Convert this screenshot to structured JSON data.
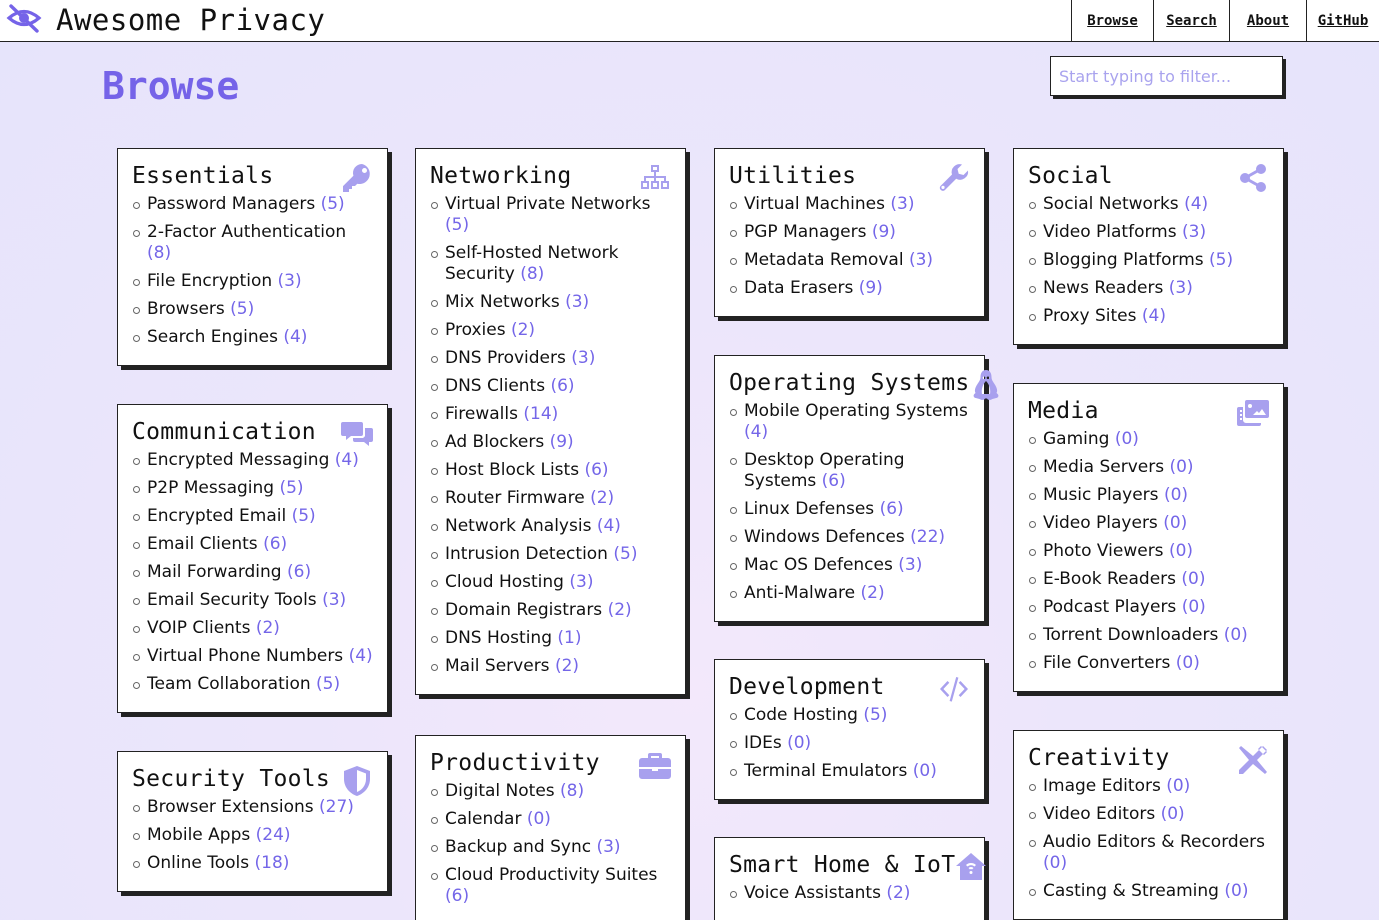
{
  "nav": {
    "brand": "Awesome Privacy",
    "links": [
      "Browse",
      "Search",
      "About",
      "GitHub"
    ]
  },
  "page": {
    "title": "Browse",
    "filter_placeholder": "Start typing to filter..."
  },
  "colors": {
    "accent": "#7563e8",
    "icon": "#a8a0ee",
    "border": "#222222"
  },
  "cards": [
    {
      "title": "Essentials",
      "icon": "key-icon",
      "items": [
        {
          "label": "Password Managers",
          "count": "(5)"
        },
        {
          "label": "2-Factor Authentication",
          "count": "(8)"
        },
        {
          "label": "File Encryption",
          "count": "(3)"
        },
        {
          "label": "Browsers",
          "count": "(5)"
        },
        {
          "label": "Search Engines",
          "count": "(4)"
        }
      ]
    },
    {
      "title": "Communication",
      "icon": "chat-icon",
      "items": [
        {
          "label": "Encrypted Messaging",
          "count": "(4)"
        },
        {
          "label": "P2P Messaging",
          "count": "(5)"
        },
        {
          "label": "Encrypted Email",
          "count": "(5)"
        },
        {
          "label": "Email Clients",
          "count": "(6)"
        },
        {
          "label": "Mail Forwarding",
          "count": "(6)"
        },
        {
          "label": "Email Security Tools",
          "count": "(3)"
        },
        {
          "label": "VOIP Clients",
          "count": "(2)"
        },
        {
          "label": "Virtual Phone Numbers",
          "count": "(4)"
        },
        {
          "label": "Team Collaboration",
          "count": "(5)"
        }
      ]
    },
    {
      "title": "Security Tools",
      "icon": "shield-icon",
      "items": [
        {
          "label": "Browser Extensions",
          "count": "(27)"
        },
        {
          "label": "Mobile Apps",
          "count": "(24)"
        },
        {
          "label": "Online Tools",
          "count": "(18)"
        }
      ]
    },
    {
      "title": "Networking",
      "icon": "network-icon",
      "items": [
        {
          "label": "Virtual Private Networks",
          "count": "(5)"
        },
        {
          "label": "Self-Hosted Network Security",
          "count": "(8)"
        },
        {
          "label": "Mix Networks",
          "count": "(3)"
        },
        {
          "label": "Proxies",
          "count": "(2)"
        },
        {
          "label": "DNS Providers",
          "count": "(3)"
        },
        {
          "label": "DNS Clients",
          "count": "(6)"
        },
        {
          "label": "Firewalls",
          "count": "(14)"
        },
        {
          "label": "Ad Blockers",
          "count": "(9)"
        },
        {
          "label": "Host Block Lists",
          "count": "(6)"
        },
        {
          "label": "Router Firmware",
          "count": "(2)"
        },
        {
          "label": "Network Analysis",
          "count": "(4)"
        },
        {
          "label": "Intrusion Detection",
          "count": "(5)"
        },
        {
          "label": "Cloud Hosting",
          "count": "(3)"
        },
        {
          "label": "Domain Registrars",
          "count": "(2)"
        },
        {
          "label": "DNS Hosting",
          "count": "(1)"
        },
        {
          "label": "Mail Servers",
          "count": "(2)"
        }
      ]
    },
    {
      "title": "Productivity",
      "icon": "briefcase-icon",
      "items": [
        {
          "label": "Digital Notes",
          "count": "(8)"
        },
        {
          "label": "Calendar",
          "count": "(0)"
        },
        {
          "label": "Backup and Sync",
          "count": "(3)"
        },
        {
          "label": "Cloud Productivity Suites",
          "count": "(6)"
        }
      ]
    },
    {
      "title": "Utilities",
      "icon": "wrench-icon",
      "items": [
        {
          "label": "Virtual Machines",
          "count": "(3)"
        },
        {
          "label": "PGP Managers",
          "count": "(9)"
        },
        {
          "label": "Metadata Removal",
          "count": "(3)"
        },
        {
          "label": "Data Erasers",
          "count": "(9)"
        }
      ]
    },
    {
      "title": "Operating Systems",
      "icon": "penguin-icon",
      "items": [
        {
          "label": "Mobile Operating Systems",
          "count": "(4)"
        },
        {
          "label": "Desktop Operating Systems",
          "count": "(6)"
        },
        {
          "label": "Linux Defenses",
          "count": "(6)"
        },
        {
          "label": "Windows Defences",
          "count": "(22)"
        },
        {
          "label": "Mac OS Defences",
          "count": "(3)"
        },
        {
          "label": "Anti-Malware",
          "count": "(2)"
        }
      ]
    },
    {
      "title": "Development",
      "icon": "code-icon",
      "items": [
        {
          "label": "Code Hosting",
          "count": "(5)"
        },
        {
          "label": "IDEs",
          "count": "(0)"
        },
        {
          "label": "Terminal Emulators",
          "count": "(0)"
        }
      ]
    },
    {
      "title": "Smart Home & IoT",
      "icon": "smart-home-icon",
      "items": [
        {
          "label": "Voice Assistants",
          "count": "(2)"
        }
      ]
    },
    {
      "title": "Social",
      "icon": "share-icon",
      "items": [
        {
          "label": "Social Networks",
          "count": "(4)"
        },
        {
          "label": "Video Platforms",
          "count": "(3)"
        },
        {
          "label": "Blogging Platforms",
          "count": "(5)"
        },
        {
          "label": "News Readers",
          "count": "(3)"
        },
        {
          "label": "Proxy Sites",
          "count": "(4)"
        }
      ]
    },
    {
      "title": "Media",
      "icon": "photo-film-icon",
      "items": [
        {
          "label": "Gaming",
          "count": "(0)"
        },
        {
          "label": "Media Servers",
          "count": "(0)"
        },
        {
          "label": "Music Players",
          "count": "(0)"
        },
        {
          "label": "Video Players",
          "count": "(0)"
        },
        {
          "label": "Photo Viewers",
          "count": "(0)"
        },
        {
          "label": "E-Book Readers",
          "count": "(0)"
        },
        {
          "label": "Podcast Players",
          "count": "(0)"
        },
        {
          "label": "Torrent Downloaders",
          "count": "(0)"
        },
        {
          "label": "File Converters",
          "count": "(0)"
        }
      ]
    },
    {
      "title": "Creativity",
      "icon": "tools-icon",
      "items": [
        {
          "label": "Image Editors",
          "count": "(0)"
        },
        {
          "label": "Video Editors",
          "count": "(0)"
        },
        {
          "label": "Audio Editors & Recorders",
          "count": "(0)"
        },
        {
          "label": "Casting & Streaming",
          "count": "(0)"
        }
      ]
    }
  ]
}
